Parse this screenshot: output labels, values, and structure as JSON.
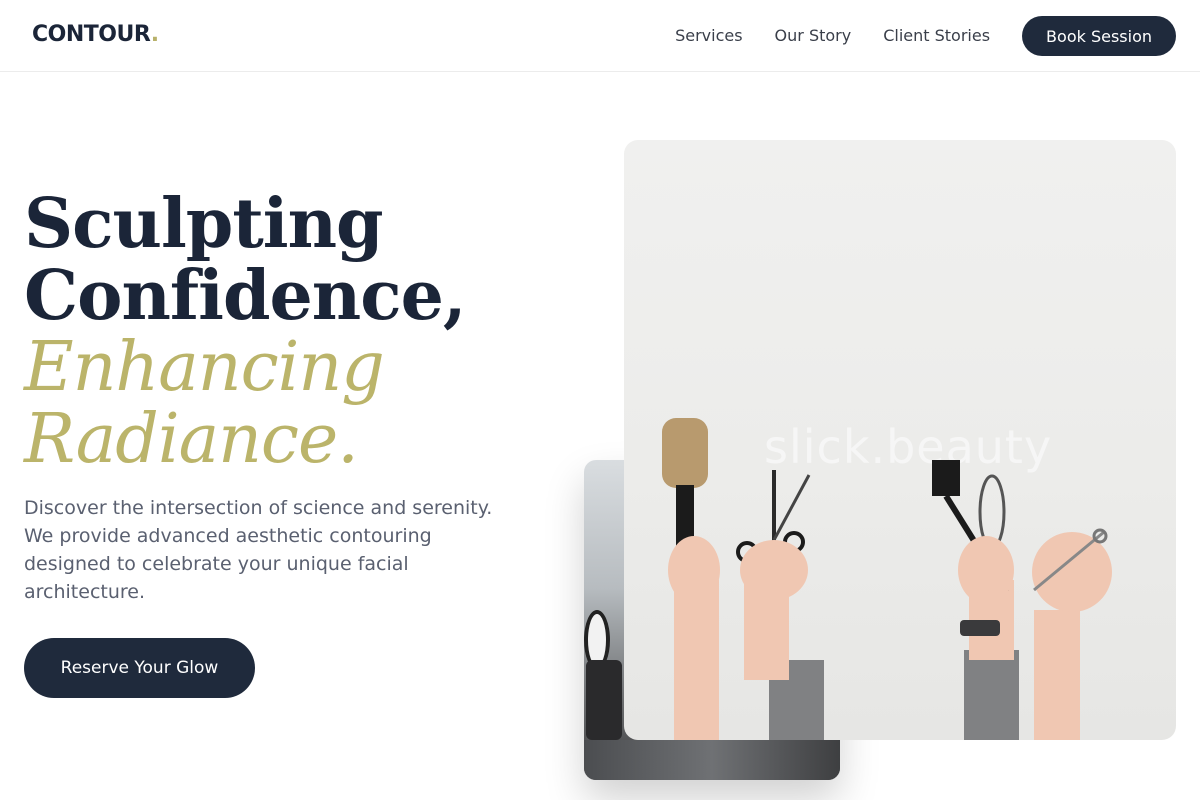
{
  "header": {
    "logo_text": "CONTOUR",
    "logo_dot": ".",
    "nav": [
      {
        "label": "Services"
      },
      {
        "label": "Our Story"
      },
      {
        "label": "Client Stories"
      }
    ],
    "book_label": "Book Session"
  },
  "hero": {
    "title_line1": "Sculpting",
    "title_line2": "Confidence,",
    "title_line3": "Enhancing",
    "title_line4": "Radiance.",
    "description": "Discover the intersection of science and serenity. We provide advanced aesthetic contouring designed to celebrate your unique facial architecture.",
    "cta_label": "Reserve Your Glow"
  },
  "images": {
    "front_watermark": "slick.beauty"
  },
  "colors": {
    "navy": "#1f2a3c",
    "gold": "#bbb46a"
  }
}
